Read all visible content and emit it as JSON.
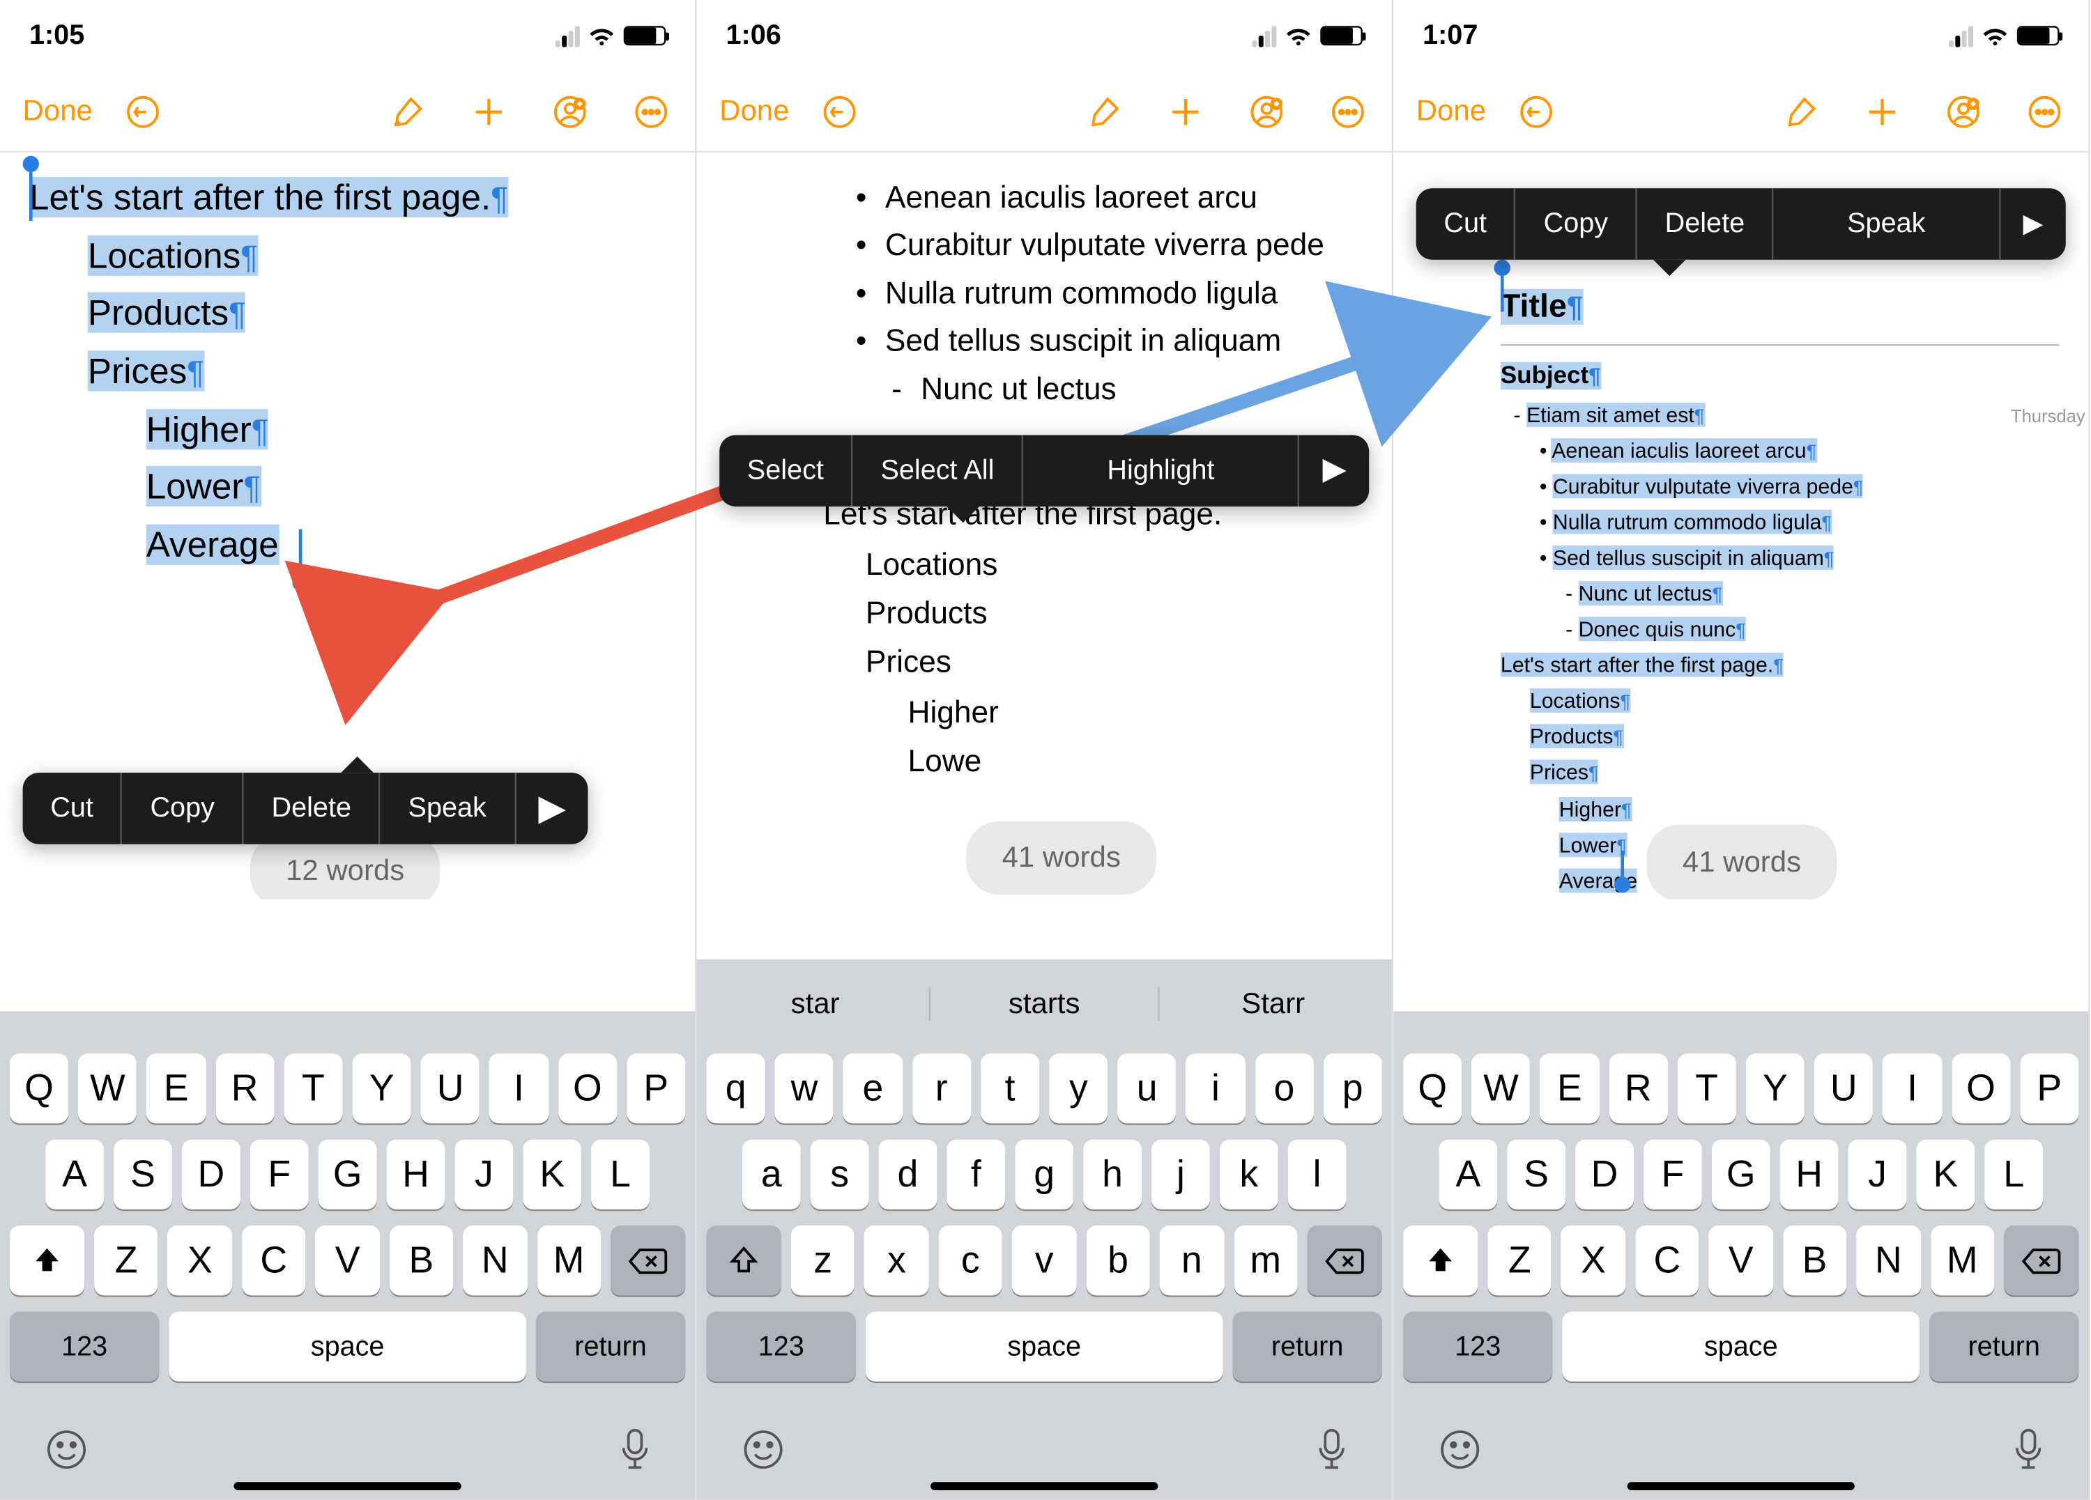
{
  "phones": [
    {
      "time": "1:05",
      "done": "Done",
      "content": {
        "line0": "Let's start after the first page.",
        "items": [
          "Locations",
          "Products",
          "Prices"
        ],
        "sub": [
          "Higher",
          "Lower",
          "Average"
        ]
      },
      "popup": [
        "Cut",
        "Copy",
        "Delete",
        "Speak"
      ],
      "pill": "12 words",
      "keyboard": {
        "row1": [
          "Q",
          "W",
          "E",
          "R",
          "T",
          "Y",
          "U",
          "I",
          "O",
          "P"
        ],
        "row2": [
          "A",
          "S",
          "D",
          "F",
          "G",
          "H",
          "J",
          "K",
          "L"
        ],
        "row3": [
          "Z",
          "X",
          "C",
          "V",
          "B",
          "N",
          "M"
        ],
        "shift_filled": true,
        "suggestions": [],
        "num": "123",
        "space": "space",
        "return": "return"
      }
    },
    {
      "time": "1:06",
      "done": "Done",
      "bullets": [
        "Aenean iaculis laoreet arcu",
        "Curabitur vulputate viverra pede",
        "Nulla rutrum commodo ligula",
        "Sed tellus suscipit in aliquam"
      ],
      "dash": [
        "Nunc ut lectus"
      ],
      "popup": [
        "Select",
        "Select All",
        "Highlight"
      ],
      "line0": "Let's start after the first page.",
      "items": [
        "Locations",
        "Products",
        "Prices"
      ],
      "sub": [
        "Higher",
        "Lowe"
      ],
      "pill": "41 words",
      "keyboard": {
        "row1": [
          "q",
          "w",
          "e",
          "r",
          "t",
          "y",
          "u",
          "i",
          "o",
          "p"
        ],
        "row2": [
          "a",
          "s",
          "d",
          "f",
          "g",
          "h",
          "j",
          "k",
          "l"
        ],
        "row3": [
          "z",
          "x",
          "c",
          "v",
          "b",
          "n",
          "m"
        ],
        "shift_filled": false,
        "suggestions": [
          "star",
          "starts",
          "Starr"
        ],
        "num": "123",
        "space": "space",
        "return": "return"
      }
    },
    {
      "time": "1:07",
      "done": "Done",
      "popup": [
        "Cut",
        "Copy",
        "Delete",
        "Speak"
      ],
      "thursday": "Thursday",
      "title": "Title",
      "subject": "Subject",
      "dash1": "Etiam sit amet est",
      "bullets": [
        "Aenean iaculis laoreet arcu",
        "Curabitur vulputate viverra pede",
        "Nulla rutrum commodo ligula",
        "Sed tellus suscipit in aliquam"
      ],
      "dash2": [
        "Nunc ut lectus",
        "Donec quis nunc"
      ],
      "line0": "Let's start after the first page.",
      "items": [
        "Locations",
        "Products",
        "Prices"
      ],
      "sub": [
        "Higher",
        "Lower",
        "Average"
      ],
      "pill": "41 words",
      "keyboard": {
        "row1": [
          "Q",
          "W",
          "E",
          "R",
          "T",
          "Y",
          "U",
          "I",
          "O",
          "P"
        ],
        "row2": [
          "A",
          "S",
          "D",
          "F",
          "G",
          "H",
          "J",
          "K",
          "L"
        ],
        "row3": [
          "Z",
          "X",
          "C",
          "V",
          "B",
          "N",
          "M"
        ],
        "shift_filled": true,
        "suggestions": [],
        "num": "123",
        "space": "space",
        "return": "return"
      }
    }
  ]
}
